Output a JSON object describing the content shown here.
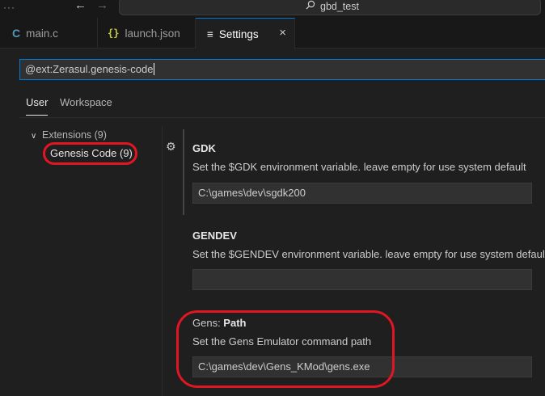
{
  "titlebar": {
    "command_center_text": "gbd_test"
  },
  "tabs": [
    {
      "icon": "C",
      "label": "main.c"
    },
    {
      "icon": "{}",
      "label": "launch.json"
    },
    {
      "icon": "≡",
      "label": "Settings",
      "close": "×"
    }
  ],
  "settings": {
    "search_value": "@ext:Zerasul.genesis-code",
    "scopes": {
      "user": "User",
      "workspace": "Workspace"
    },
    "toc": {
      "extensions": "Extensions (9)",
      "genesis_code": "Genesis Code (9)"
    },
    "items": [
      {
        "title": "GDK",
        "description": "Set the $GDK environment variable. leave empty for use system default",
        "value": "C:\\games\\dev\\sgdk200"
      },
      {
        "title": "GENDEV",
        "description": "Set the $GENDEV environment variable. leave empty for use system default",
        "value": ""
      },
      {
        "category": "Gens: ",
        "title": "Path",
        "description": "Set the Gens Emulator command path",
        "value": "C:\\games\\dev\\Gens_KMod\\gens.exe"
      }
    ]
  },
  "colors": {
    "accent": "#0078d4",
    "annotation": "#e01622",
    "background": "#1f1f1f"
  }
}
